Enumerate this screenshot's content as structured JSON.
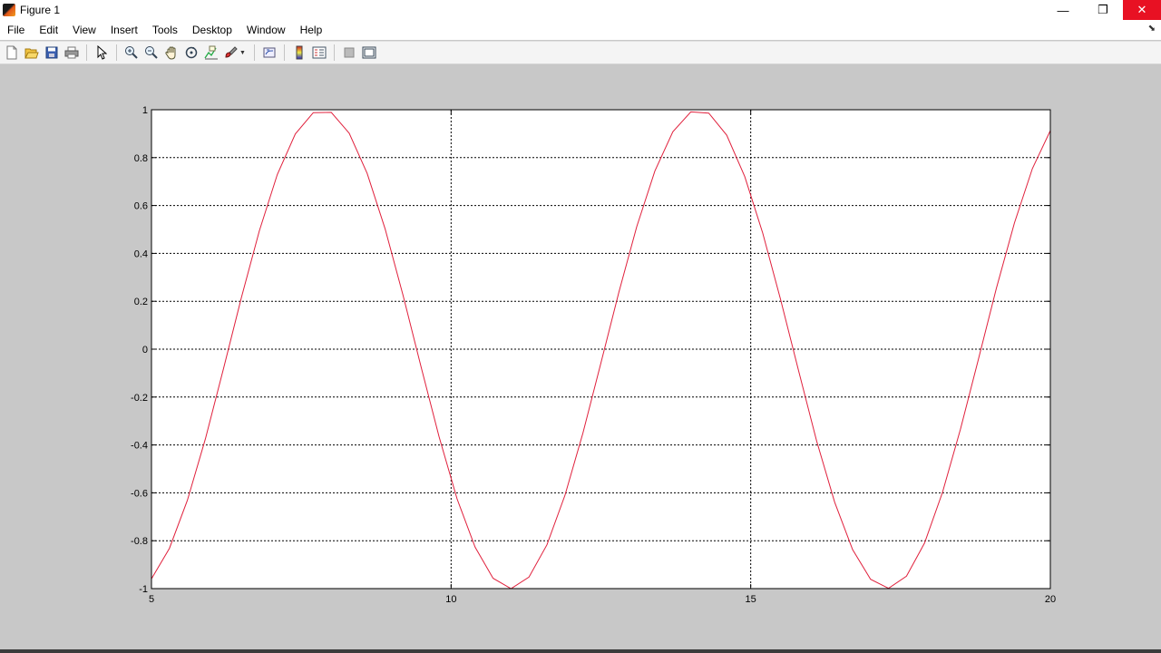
{
  "window": {
    "title": "Figure 1"
  },
  "controls": {
    "minimize": "—",
    "restore": "❐",
    "close": "✕"
  },
  "menu": [
    "File",
    "Edit",
    "View",
    "Insert",
    "Tools",
    "Desktop",
    "Window",
    "Help"
  ],
  "toolbar": {
    "icons": [
      "new-figure-icon",
      "open-file-icon",
      "save-icon",
      "print-icon",
      "edit-plot-icon",
      "zoom-in-icon",
      "zoom-out-icon",
      "pan-icon",
      "rotate-3d-icon",
      "data-cursor-icon",
      "brush-icon",
      "link-plot-icon",
      "colorbar-icon",
      "legend-icon",
      "hide-plot-tools-icon",
      "show-plot-tools-icon"
    ]
  },
  "chart_data": {
    "type": "line",
    "function_samples_x_range": [
      5,
      20
    ],
    "xlim": [
      5,
      20
    ],
    "ylim": [
      -1,
      1
    ],
    "xticks": [
      5,
      10,
      15,
      20
    ],
    "yticks": [
      -1,
      -0.8,
      -0.6,
      -0.4,
      -0.2,
      0,
      0.2,
      0.4,
      0.6,
      0.8,
      1
    ],
    "xtick_labels": [
      "5",
      "10",
      "15",
      "20"
    ],
    "ytick_labels": [
      "-1",
      "-0.8",
      "-0.6",
      "-0.4",
      "-0.2",
      "0",
      "0.2",
      "0.4",
      "0.6",
      "0.8",
      "1"
    ],
    "grid": true,
    "series": [
      {
        "color": "#e0203c",
        "x": [
          5.0,
          5.3,
          5.6,
          5.9,
          6.2,
          6.5,
          6.8,
          7.1,
          7.4,
          7.7,
          8.0,
          8.3,
          8.6,
          8.9,
          9.2,
          9.5,
          9.8,
          10.1,
          10.4,
          10.7,
          11.0,
          11.3,
          11.6,
          11.9,
          12.2,
          12.5,
          12.8,
          13.1,
          13.4,
          13.7,
          14.0,
          14.3,
          14.6,
          14.9,
          15.2,
          15.5,
          15.8,
          16.1,
          16.4,
          16.7,
          17.0,
          17.3,
          17.6,
          17.9,
          18.2,
          18.5,
          18.8,
          19.1,
          19.4,
          19.7,
          20.0
        ],
        "y": [
          -0.959,
          -0.832,
          -0.631,
          -0.374,
          -0.083,
          0.215,
          0.494,
          0.729,
          0.899,
          0.988,
          0.989,
          0.902,
          0.734,
          0.501,
          0.223,
          -0.075,
          -0.366,
          -0.625,
          -0.827,
          -0.957,
          -1.0,
          -0.952,
          -0.817,
          -0.61,
          -0.35,
          -0.058,
          0.238,
          0.513,
          0.744,
          0.908,
          0.991,
          0.986,
          0.894,
          0.721,
          0.485,
          0.206,
          -0.091,
          -0.383,
          -0.639,
          -0.837,
          -0.961,
          -0.999,
          -0.948,
          -0.81,
          -0.598,
          -0.334,
          -0.042,
          0.254,
          0.527,
          0.754,
          0.913
        ]
      }
    ]
  }
}
